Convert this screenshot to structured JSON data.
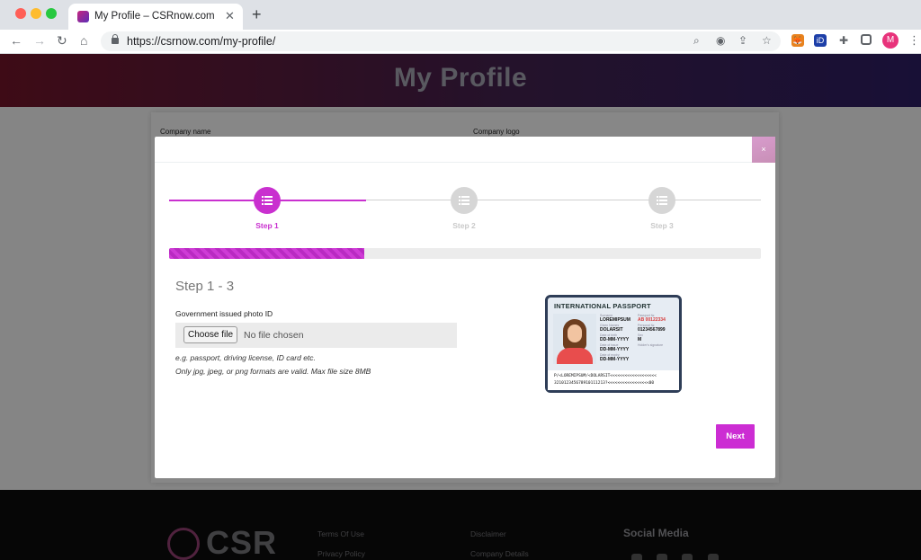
{
  "browser": {
    "tab_title": "My Profile – CSRnow.com",
    "tab_close": "✕",
    "new_tab": "+",
    "url": "https://csrnow.com/my-profile/",
    "profile_initial": "M",
    "extension_id_label": "iD"
  },
  "page": {
    "hero_title": "My Profile",
    "company_name_label": "Company name",
    "company_logo_label": "Company logo"
  },
  "modal": {
    "close_label": "×",
    "steps": [
      {
        "label": "Step 1",
        "state": "active"
      },
      {
        "label": "Step 2",
        "state": "inactive"
      },
      {
        "label": "Step 3",
        "state": "inactive"
      }
    ],
    "progress_fraction": 0.33,
    "step_heading": "Step 1 - 3",
    "field_label": "Government issued photo ID",
    "file_button_label": "Choose file",
    "file_status": "No file chosen",
    "help_line_1": "e.g. passport, driving license, ID card etc.",
    "help_line_2": "Only jpg, jpeg, or png formats are valid. Max file size 8MB",
    "next_label": "Next",
    "accent_color": "#cc2dd3"
  },
  "passport": {
    "title": "INTERNATIONAL PASSPORT",
    "surname": "LOREMIPSUM",
    "given_name": "DOLARSIT",
    "passport_no": "AB 00122334",
    "personal_no": "01234567899",
    "date_1": "DD-MM-YYYY",
    "sex": "M",
    "date_2": "DD-MM-YYYY",
    "date_3": "DD-MM-YYYY",
    "mrz_1": "P/<LOREMIPSUM/<DOLARSIT<<<<<<<<<<<<<<<<<<<",
    "mrz_2": "321012345678910111213?<<<<<<<<<<<<<<<<<00"
  },
  "footer": {
    "logo_text": "CSR",
    "links": [
      "Terms Of Use",
      "Privacy Policy",
      "Disclaimer",
      "Company Details"
    ],
    "social_heading": "Social Media"
  }
}
